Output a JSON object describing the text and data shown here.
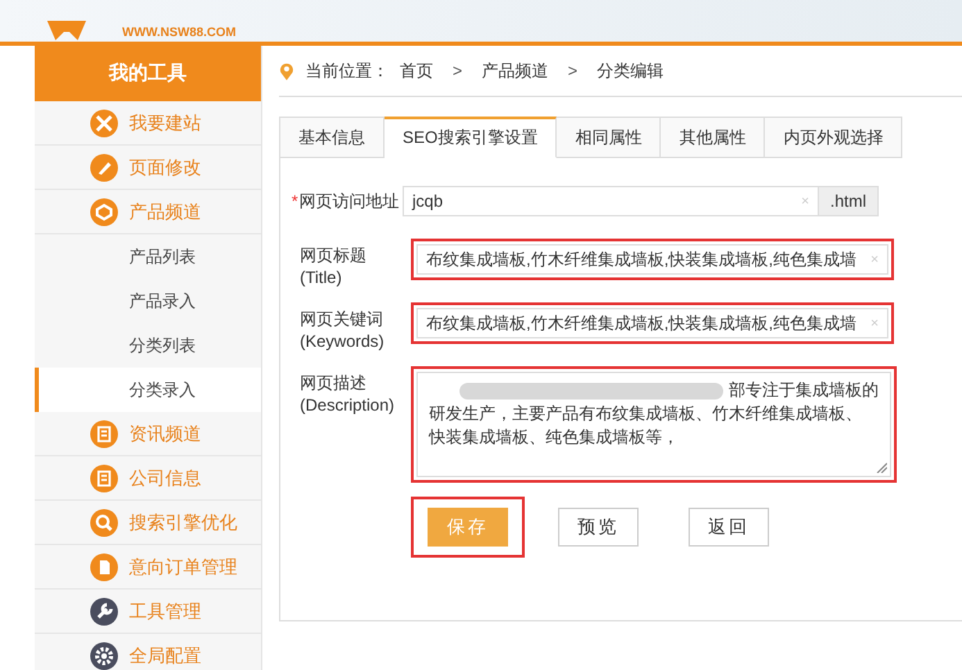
{
  "header": {
    "logo_url": "WWW.NSW88.COM"
  },
  "sidebar": {
    "title": "我的工具",
    "items": [
      {
        "label": "我要建站"
      },
      {
        "label": "页面修改"
      },
      {
        "label": "产品频道",
        "children": [
          {
            "label": "产品列表",
            "selected": false
          },
          {
            "label": "产品录入",
            "selected": false
          },
          {
            "label": "分类列表",
            "selected": false
          },
          {
            "label": "分类录入",
            "selected": true
          }
        ]
      },
      {
        "label": "资讯频道"
      },
      {
        "label": "公司信息"
      },
      {
        "label": "搜索引擎优化"
      },
      {
        "label": "意向订单管理"
      },
      {
        "label": "工具管理"
      },
      {
        "label": "全局配置"
      }
    ]
  },
  "breadcrumb": {
    "label": "当前位置：",
    "items": [
      "首页",
      "产品频道",
      "分类编辑"
    ],
    "separator": ">"
  },
  "tabs": [
    {
      "label": "基本信息",
      "selected": false
    },
    {
      "label": "SEO搜索引擎设置",
      "selected": true
    },
    {
      "label": "相同属性",
      "selected": false
    },
    {
      "label": "其他属性",
      "selected": false
    },
    {
      "label": "内页外观选择",
      "selected": false
    }
  ],
  "form": {
    "url": {
      "label": "网页访问地址",
      "required_mark": "*",
      "value": "jcqb",
      "suffix": ".html",
      "clear": "×"
    },
    "title": {
      "label": "网页标题",
      "sublabel": "(Title)",
      "value": "布纹集成墙板,竹木纤维集成墙板,快装集成墙板,纯色集成墙",
      "clear": "×",
      "highlighted": true
    },
    "keywords": {
      "label": "网页关键词",
      "sublabel": "(Keywords)",
      "value": "布纹集成墙板,竹木纤维集成墙板,快装集成墙板,纯色集成墙",
      "clear": "×",
      "highlighted": true
    },
    "description": {
      "label": "网页描述",
      "sublabel": "(Description)",
      "lines": [
        "部专注于集成墙板的",
        "研发生产，主要产品有布纹集成墙板、竹木纤维集成墙板、快装集成墙板、纯色集成墙板等，"
      ],
      "highlighted": true
    }
  },
  "buttons": [
    {
      "label": "保存",
      "kind": "primary",
      "highlighted": true
    },
    {
      "label": "预览",
      "kind": "default",
      "highlighted": false
    },
    {
      "label": "返回",
      "kind": "default",
      "highlighted": false
    }
  ]
}
